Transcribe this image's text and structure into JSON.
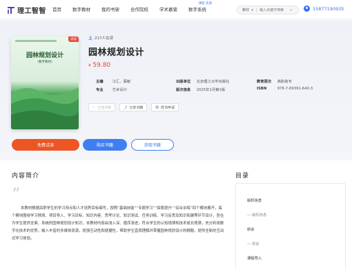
{
  "header": {
    "logo_text": "理工智智",
    "nav": [
      {
        "label": "首页",
        "badge": ""
      },
      {
        "label": "数字教材",
        "badge": ""
      },
      {
        "label": "我的书架",
        "badge": ""
      },
      {
        "label": "合作院校",
        "badge": ""
      },
      {
        "label": "学术慕萱",
        "badge": ""
      },
      {
        "label": "数字系统",
        "badge": "课程 资源"
      }
    ],
    "search": {
      "type": "教材",
      "placeholder": "输入关键字搜索"
    },
    "user_phone": "15877190935"
  },
  "book": {
    "cover": {
      "tag": "试读",
      "title": "园林规划设计",
      "subtitle": "（数字教材）"
    },
    "reads": "217人在读",
    "title": "园林规划设计",
    "price_symbol": "¥",
    "price": "59.80",
    "meta": [
      {
        "label": "主编",
        "value": "江汇、蔡敏"
      },
      {
        "label": "出版单位",
        "value": "北京理工大学出版社"
      },
      {
        "label": "教育层次",
        "value": "高职高专"
      },
      {
        "label": "专业",
        "value": "艺术设计"
      },
      {
        "label": "版次信息",
        "value": "2025年1月第1版"
      },
      {
        "label": "ISBN",
        "value": "978-7-89391-640-3"
      }
    ],
    "actions": [
      {
        "label": "已加书架",
        "icon": "check"
      },
      {
        "label": "分享书籍",
        "icon": "share"
      },
      {
        "label": "样书申请",
        "icon": "book"
      }
    ],
    "cta": {
      "try": "免费试读",
      "buy": "购买书籍",
      "get": "获取书籍"
    }
  },
  "intro": {
    "title": "内容简介",
    "text": "本教材根据高职学生的学习特点和人才培养目标编写，按照“基础技能”“专题学习”“探索提升”“综合训练”四个模块展开，每个模块围绕学习情境、项目导入、学习目标、知识内容、思考讨论、知识测试、任务训练、学习反思及知识拓展等环节设计，旨在为学生提供全面、系统的园林规划设计知识。本教材内容由浅入深、循序渐进，符合学生的认知规律和技术成长规律，充分利用数字化技术的优势，嵌入丰富的多媒体资源，增强互动性和便捷性，帮助学生直观理解并掌握园林规划设计的精髓，提供全新的互动式学习体验。"
  },
  "toc": {
    "title": "目录",
    "items": [
      {
        "label": "版权信息",
        "level": 1
      },
      {
        "label": "— 版权信息",
        "level": 2
      },
      {
        "label": "前言",
        "level": 1
      },
      {
        "label": "— 前言",
        "level": 2
      },
      {
        "label": "课程导入",
        "level": 1
      }
    ]
  }
}
